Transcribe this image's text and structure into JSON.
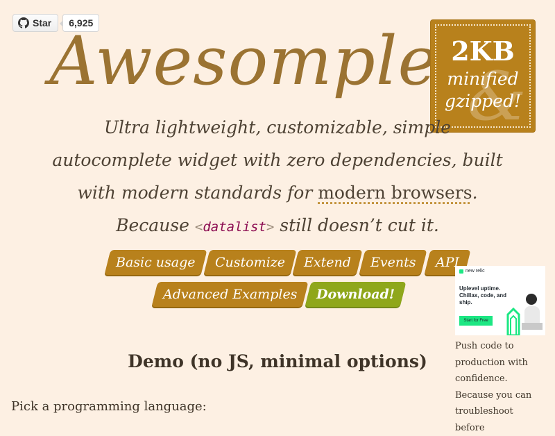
{
  "github": {
    "star_label": "Star",
    "star_count": "6,925"
  },
  "header": {
    "title": "Awesomplete"
  },
  "badge": {
    "size": "2KB",
    "line1": "minified",
    "line2": "gzipped!",
    "ampersand": "&"
  },
  "tagline": {
    "part1": "Ultra lightweight, customizable, simple autocomplete widget with zero dependencies, built with modern standards for ",
    "link": "modern browsers",
    "part2": ". Because ",
    "code_open": "<",
    "code": "datalist",
    "code_close": ">",
    "part3": " still doesn’t cut it."
  },
  "nav": {
    "basic_usage": "Basic usage",
    "customize": "Customize",
    "extend": "Extend",
    "events": "Events",
    "api": "API",
    "advanced_examples": "Advanced Examples",
    "download": "Download!"
  },
  "ad": {
    "brand": "new relic",
    "headline": "Uplevel uptime. Chillax, code, and ship.",
    "cta": "Start for Free",
    "text": "Push code to production with confidence. Because you can troubleshoot before"
  },
  "demo": {
    "title": "Demo (no JS, minimal options)",
    "pick_label": "Pick a programming language:"
  },
  "colors": {
    "background": "#fdf0e3",
    "accent": "#b8811c",
    "title": "#9b7332",
    "download": "#8fa71b",
    "code": "#8b0a50"
  }
}
